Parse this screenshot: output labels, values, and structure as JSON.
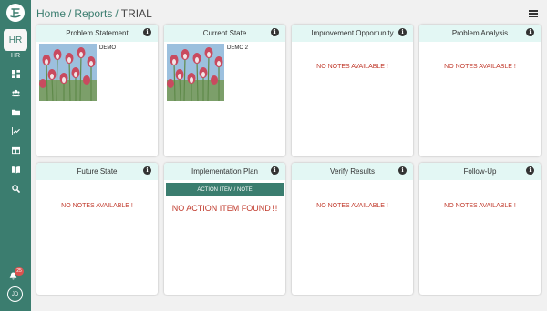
{
  "sidebar": {
    "logo": "company-logo",
    "hr_box": "HR",
    "hr_label": "HR",
    "nav_icons": [
      "dashboard-icon",
      "users-icon",
      "folder-icon",
      "chart-icon",
      "table-icon",
      "book-icon",
      "search-icon"
    ],
    "notifications_count": "25",
    "avatar_initials": "JD"
  },
  "header": {
    "breadcrumb": [
      "Home",
      "Reports",
      "TRIAL"
    ],
    "separator": "/"
  },
  "cards": [
    {
      "title": "Problem Statement",
      "image_caption": "DEMO"
    },
    {
      "title": "Current State",
      "image_caption": "DEMO 2"
    },
    {
      "title": "Improvement Opportunity",
      "empty_text": "NO NOTES AVAILABLE !"
    },
    {
      "title": "Problem Analysis",
      "empty_text": "NO NOTES AVAILABLE !"
    },
    {
      "title": "Future State",
      "empty_text": "NO NOTES AVAILABLE !"
    },
    {
      "title": "Implementation Plan",
      "action_label": "ACTION ITEM / NOTE",
      "empty_text": "NO ACTION ITEM FOUND !!"
    },
    {
      "title": "Verify Results",
      "empty_text": "NO NOTES AVAILABLE !"
    },
    {
      "title": "Follow-Up",
      "empty_text": "NO NOTES AVAILABLE !"
    }
  ],
  "info_glyph": "i",
  "colors": {
    "accent": "#3b7d6f",
    "card_header": "#e3f7f4",
    "error_text": "#c0392b"
  }
}
